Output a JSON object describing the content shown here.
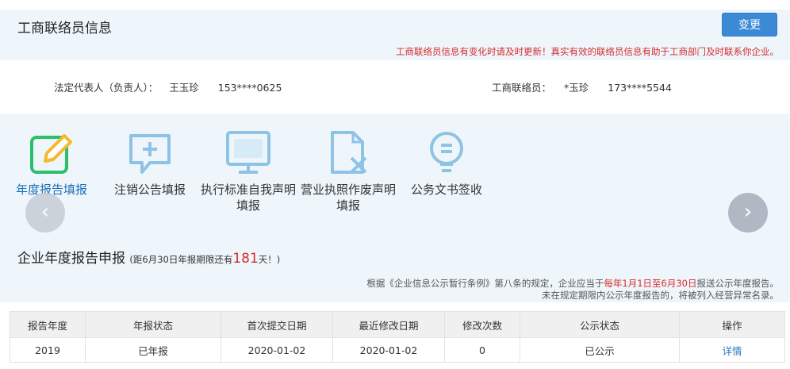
{
  "contact": {
    "title": "工商联络员信息",
    "change_button": "变更",
    "notice": "工商联络员信息有变化时请及时更新！真实有效的联络员信息有助于工商部门及时联系你企业。",
    "legal_rep_label": "法定代表人（负责人）：",
    "legal_rep_name": "王玉珍",
    "legal_rep_phone": "153****0625",
    "liaison_label": "工商联络员：",
    "liaison_name": "*玉珍",
    "liaison_phone": "173****5544"
  },
  "quick_actions": [
    {
      "label": "年度报告填报",
      "icon": "edit-icon",
      "active": true
    },
    {
      "label": "注销公告填报",
      "icon": "chat-plus-icon",
      "active": false
    },
    {
      "label": "执行标准自我声明填报",
      "icon": "monitor-icon",
      "active": false
    },
    {
      "label": "营业执照作废声明填报",
      "icon": "document-x-icon",
      "active": false
    },
    {
      "label": "公务文书签收",
      "icon": "bulb-icon",
      "active": false
    }
  ],
  "annual_report": {
    "title": "企业年度报告申报",
    "deadline_prefix": "(距6月30日年报期限还有",
    "days_left": "181",
    "deadline_suffix": "天！)",
    "rule_line1_a": "根据《企业信息公示暂行条例》第八条的规定，企业应当于",
    "rule_line1_red": "每年1月1日至6月30日",
    "rule_line1_b": "报送公示年度报告。",
    "rule_line2": "未在规定期限内公示年度报告的，将被列入经营异常名录。",
    "columns": [
      "报告年度",
      "年报状态",
      "首次提交日期",
      "最近修改日期",
      "修改次数",
      "公示状态",
      "操作"
    ],
    "rows": [
      [
        "2019",
        "已年报",
        "2020-01-02",
        "2020-01-02",
        "0",
        "已公示",
        "详情"
      ]
    ]
  },
  "colors": {
    "accent": "#3c8ad6",
    "warning": "#d62b2b",
    "icon_green": "#2bbf6a",
    "icon_yellow": "#f5b82e",
    "icon_blue": "#8ec3e6"
  }
}
